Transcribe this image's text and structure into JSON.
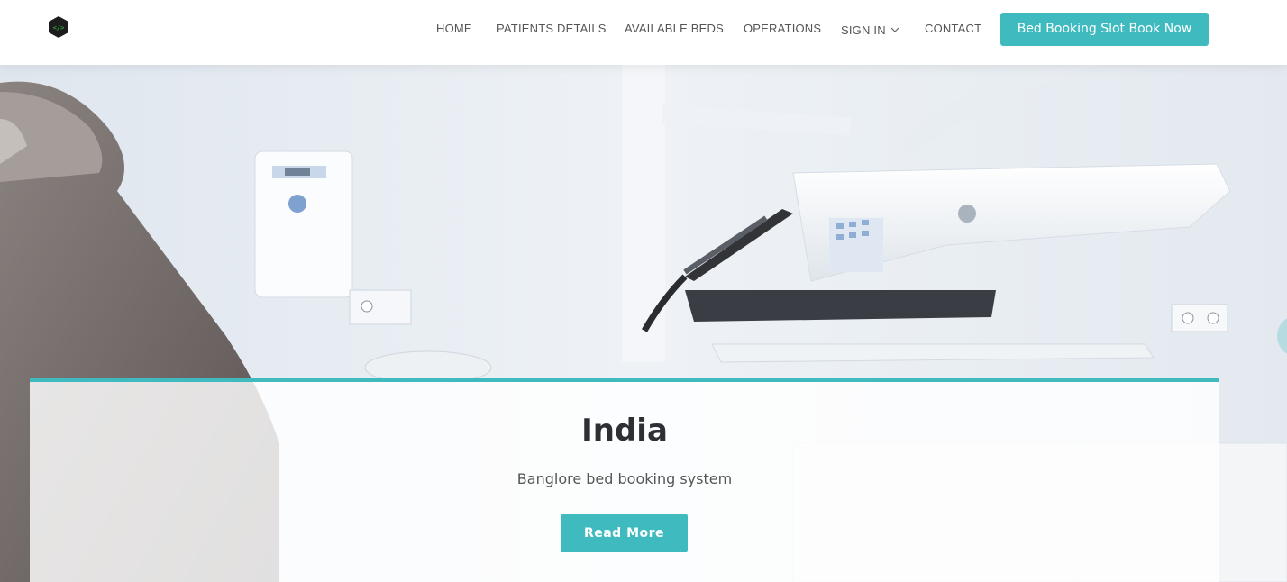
{
  "header": {
    "logo": "code-cube-logo",
    "nav": [
      {
        "label": "HOME"
      },
      {
        "label": "PATIENTS DETAILS"
      },
      {
        "label": "AVAILABLE BEDS"
      },
      {
        "label": "OPERATIONS"
      },
      {
        "label": "SIGN IN",
        "dropdown": true
      },
      {
        "label": "CONTACT"
      }
    ],
    "cta_label": "Bed Booking Slot Book Now"
  },
  "hero": {
    "image": "dental-clinic-photo",
    "title": "India",
    "subtitle": "Banglore bed booking system",
    "button_label": "Read More"
  },
  "colors": {
    "accent": "#3fbbc0",
    "heading": "#2c2f33",
    "nav_text": "#555555"
  },
  "icons": {
    "dropdown": "chevron-down-icon",
    "logo": "code-icon"
  }
}
